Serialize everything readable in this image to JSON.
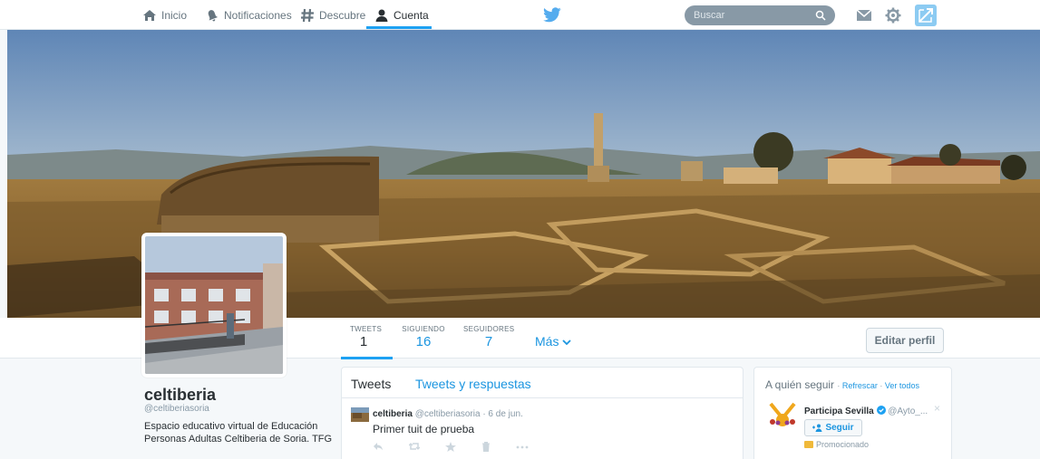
{
  "nav": {
    "items": [
      {
        "label": "Inicio"
      },
      {
        "label": "Notificaciones"
      },
      {
        "label": "Descubre"
      },
      {
        "label": "Cuenta"
      }
    ],
    "search_placeholder": "Buscar",
    "accent": "#1da1f2"
  },
  "profile": {
    "name": "celtiberia",
    "handle": "@celtiberiasoria",
    "bio": "Espacio educativo virtual de Educación Personas Adultas Celtiberia de Soria. TFG"
  },
  "stats": [
    {
      "label": "TWEETS",
      "value": "1"
    },
    {
      "label": "SIGUIENDO",
      "value": "16"
    },
    {
      "label": "SEGUIDORES",
      "value": "7"
    }
  ],
  "more_label": "Más",
  "edit_profile_label": "Editar perfil",
  "timeline": {
    "tabs": [
      {
        "label": "Tweets"
      },
      {
        "label": "Tweets y respuestas"
      }
    ],
    "tweet": {
      "author": "celtiberia",
      "meta": "@celtiberiasoria · 6 de jun.",
      "text": "Primer tuit de prueba"
    }
  },
  "who_to_follow": {
    "title": "A quién seguir",
    "refresh": "Refrescar",
    "view_all": "Ver todos",
    "account_name": "Participa Sevilla",
    "account_handle": "@Ayto_...",
    "follow_label": "Seguir",
    "promoted_label": "Promocionado"
  }
}
